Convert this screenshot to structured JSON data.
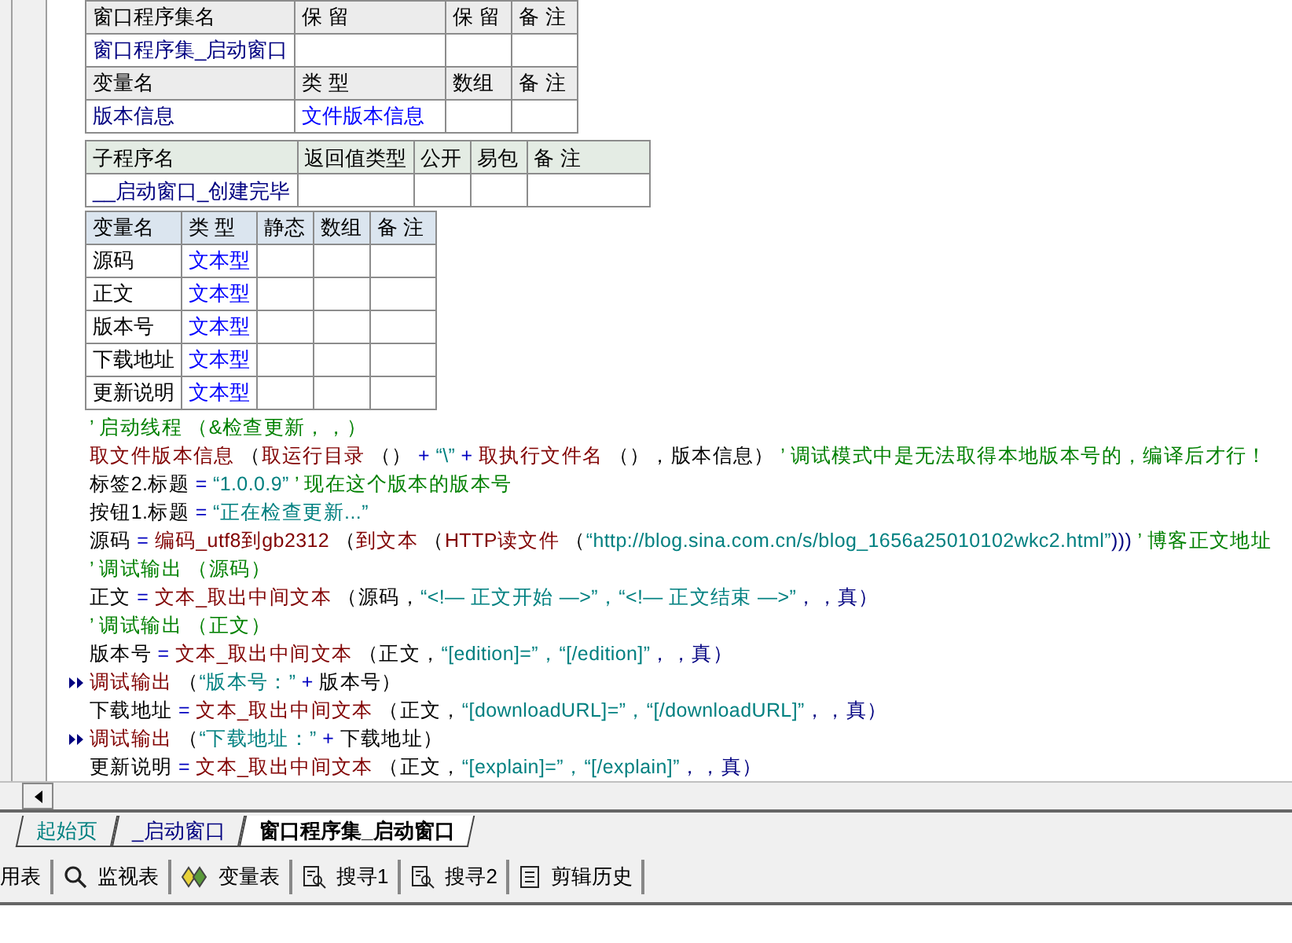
{
  "assembly_table": {
    "header": [
      "窗口程序集名",
      "保 留",
      "保 留",
      "备 注"
    ],
    "row": [
      "窗口程序集_启动窗口"
    ],
    "var_header": [
      "变量名",
      "类 型",
      "数组",
      "备 注"
    ],
    "vars": [
      [
        "版本信息",
        "文件版本信息"
      ]
    ]
  },
  "sub_table": {
    "header": [
      "子程序名",
      "返回值类型",
      "公开",
      "易包",
      "备 注"
    ],
    "row": [
      "__启动窗口_创建完毕"
    ]
  },
  "local_table": {
    "header": [
      "变量名",
      "类 型",
      "静态",
      "数组",
      "备 注"
    ],
    "rows": [
      [
        "源码",
        "文本型"
      ],
      [
        "正文",
        "文本型"
      ],
      [
        "版本号",
        "文本型"
      ],
      [
        "下载地址",
        "文本型"
      ],
      [
        "更新说明",
        "文本型"
      ]
    ]
  },
  "code_lines": [
    {
      "marked": false,
      "segments": [
        {
          "kind": "comment",
          "text": "’ 启动线程 （&检查更新，，）"
        }
      ]
    },
    {
      "marked": false,
      "segments": [
        {
          "kind": "cmd",
          "text": "取文件版本信息"
        },
        {
          "kind": "plain",
          "text": " （"
        },
        {
          "kind": "cmd",
          "text": "取运行目录"
        },
        {
          "kind": "plain",
          "text": " （） "
        },
        {
          "kind": "op",
          "text": "+"
        },
        {
          "kind": "str",
          "text": " “\\” "
        },
        {
          "kind": "op",
          "text": "+"
        },
        {
          "kind": "cmd",
          "text": " 取执行文件名"
        },
        {
          "kind": "plain",
          "text": " （），版本信息）"
        },
        {
          "kind": "comment",
          "text": " ’ 调试模式中是无法取得本地版本号的，编译后才行！"
        }
      ]
    },
    {
      "marked": false,
      "segments": [
        {
          "kind": "plain",
          "text": "标签2.标题 "
        },
        {
          "kind": "op",
          "text": "="
        },
        {
          "kind": "str",
          "text": " “1.0.0.9” "
        },
        {
          "kind": "comment",
          "text": " ’ 现在这个版本的版本号"
        }
      ]
    },
    {
      "marked": false,
      "segments": [
        {
          "kind": "plain",
          "text": "按钮1.标题 "
        },
        {
          "kind": "op",
          "text": "="
        },
        {
          "kind": "str",
          "text": " “正在检查更新...”"
        }
      ]
    },
    {
      "marked": false,
      "segments": [
        {
          "kind": "plain",
          "text": "源码 "
        },
        {
          "kind": "op",
          "text": "="
        },
        {
          "kind": "cmd",
          "text": " 编码_utf8到gb2312"
        },
        {
          "kind": "plain",
          "text": " （"
        },
        {
          "kind": "cmd",
          "text": "到文本"
        },
        {
          "kind": "plain",
          "text": " （"
        },
        {
          "kind": "cmd",
          "text": "HTTP读文件"
        },
        {
          "kind": "plain",
          "text": " （"
        },
        {
          "kind": "str",
          "text": "“http://blog.sina.com.cn/s/blog_1656a25010102wkc2.html”"
        },
        {
          "kind": "const",
          "text": ")))"
        },
        {
          "kind": "comment",
          "text": " ’ 博客正文地址"
        }
      ]
    },
    {
      "marked": false,
      "segments": [
        {
          "kind": "comment",
          "text": "’ 调试输出 （源码）"
        }
      ]
    },
    {
      "marked": false,
      "segments": [
        {
          "kind": "plain",
          "text": "正文 "
        },
        {
          "kind": "op",
          "text": "="
        },
        {
          "kind": "cmd",
          "text": " 文本_取出中间文本"
        },
        {
          "kind": "plain",
          "text": " （源码，"
        },
        {
          "kind": "str",
          "text": "“<!— 正文开始 —>”，“<!— 正文结束 —>”"
        },
        {
          "kind": "const",
          "text": "，，真）"
        }
      ]
    },
    {
      "marked": false,
      "segments": [
        {
          "kind": "comment",
          "text": "’ 调试输出 （正文）"
        }
      ]
    },
    {
      "marked": false,
      "segments": [
        {
          "kind": "plain",
          "text": "版本号 "
        },
        {
          "kind": "op",
          "text": "="
        },
        {
          "kind": "cmd",
          "text": " 文本_取出中间文本"
        },
        {
          "kind": "plain",
          "text": " （正文，"
        },
        {
          "kind": "str",
          "text": "“[edition]=”，“[/edition]”"
        },
        {
          "kind": "const",
          "text": "，，真）"
        }
      ]
    },
    {
      "marked": true,
      "segments": [
        {
          "kind": "cmd",
          "text": "调试输出"
        },
        {
          "kind": "plain",
          "text": " （"
        },
        {
          "kind": "str",
          "text": "“版本号：” "
        },
        {
          "kind": "op",
          "text": "+"
        },
        {
          "kind": "plain",
          "text": " 版本号）"
        }
      ]
    },
    {
      "marked": false,
      "segments": [
        {
          "kind": "plain",
          "text": "下载地址 "
        },
        {
          "kind": "op",
          "text": "="
        },
        {
          "kind": "cmd",
          "text": " 文本_取出中间文本"
        },
        {
          "kind": "plain",
          "text": " （正文，"
        },
        {
          "kind": "str",
          "text": "“[downloadURL]=”，“[/downloadURL]”"
        },
        {
          "kind": "const",
          "text": "，，真）"
        }
      ]
    },
    {
      "marked": true,
      "segments": [
        {
          "kind": "cmd",
          "text": "调试输出"
        },
        {
          "kind": "plain",
          "text": " （"
        },
        {
          "kind": "str",
          "text": "“下载地址：” "
        },
        {
          "kind": "op",
          "text": "+"
        },
        {
          "kind": "plain",
          "text": " 下载地址）"
        }
      ]
    },
    {
      "marked": false,
      "segments": [
        {
          "kind": "plain",
          "text": "更新说明 "
        },
        {
          "kind": "op",
          "text": "="
        },
        {
          "kind": "cmd",
          "text": " 文本_取出中间文本"
        },
        {
          "kind": "plain",
          "text": " （正文，"
        },
        {
          "kind": "str",
          "text": "“[explain]=”，“[/explain]”"
        },
        {
          "kind": "const",
          "text": "，，真）"
        }
      ]
    }
  ],
  "editor_tabs": [
    {
      "label": "起始页",
      "kind": "start",
      "selected": false
    },
    {
      "label": "_启动窗口",
      "kind": "window",
      "selected": false
    },
    {
      "label": "窗口程序集_启动窗口",
      "kind": "code",
      "selected": true
    }
  ],
  "bottom_tools": [
    {
      "label": "用表",
      "kind": "plain"
    },
    {
      "label": "监视表",
      "kind": "watch"
    },
    {
      "label": "变量表",
      "kind": "vars"
    },
    {
      "label": "搜寻1",
      "kind": "find"
    },
    {
      "label": "搜寻2",
      "kind": "find"
    },
    {
      "label": "剪辑历史",
      "kind": "clip"
    }
  ]
}
